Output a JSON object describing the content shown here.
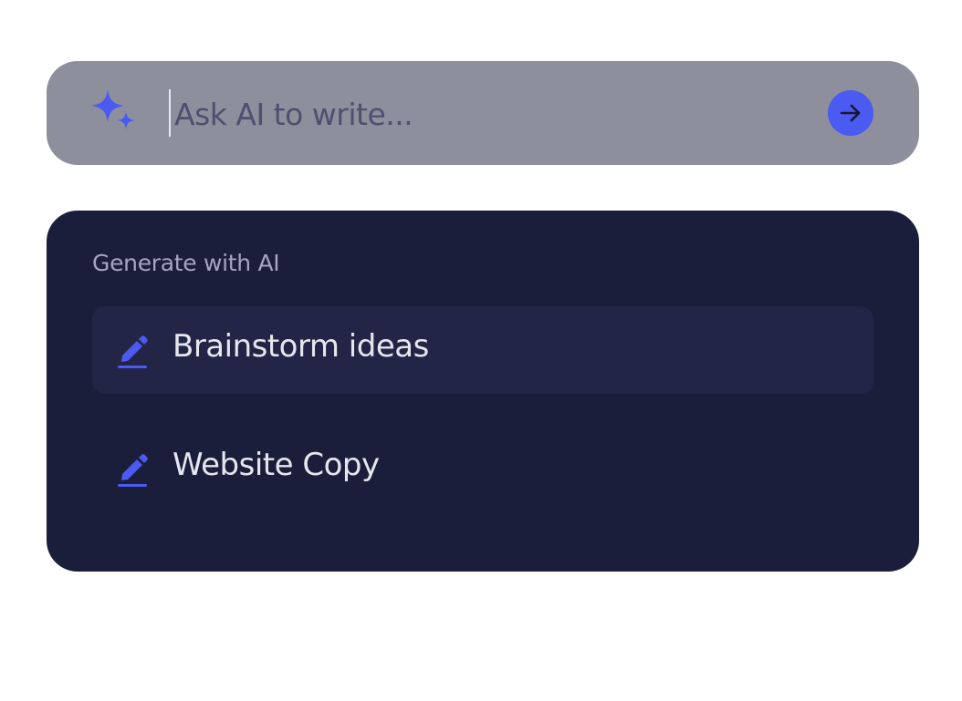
{
  "prompt": {
    "placeholder": "Ask AI to write...",
    "value": "",
    "sparkle_icon": "sparkle-icon",
    "send_icon": "arrow-right-icon",
    "accent_color": "#4b5af0"
  },
  "panel": {
    "heading": "Generate with AI",
    "items": [
      {
        "label": "Brainstorm ideas",
        "icon": "pencil-icon",
        "highlighted": true
      },
      {
        "label": "Website Copy",
        "icon": "pencil-icon",
        "highlighted": false
      }
    ]
  }
}
